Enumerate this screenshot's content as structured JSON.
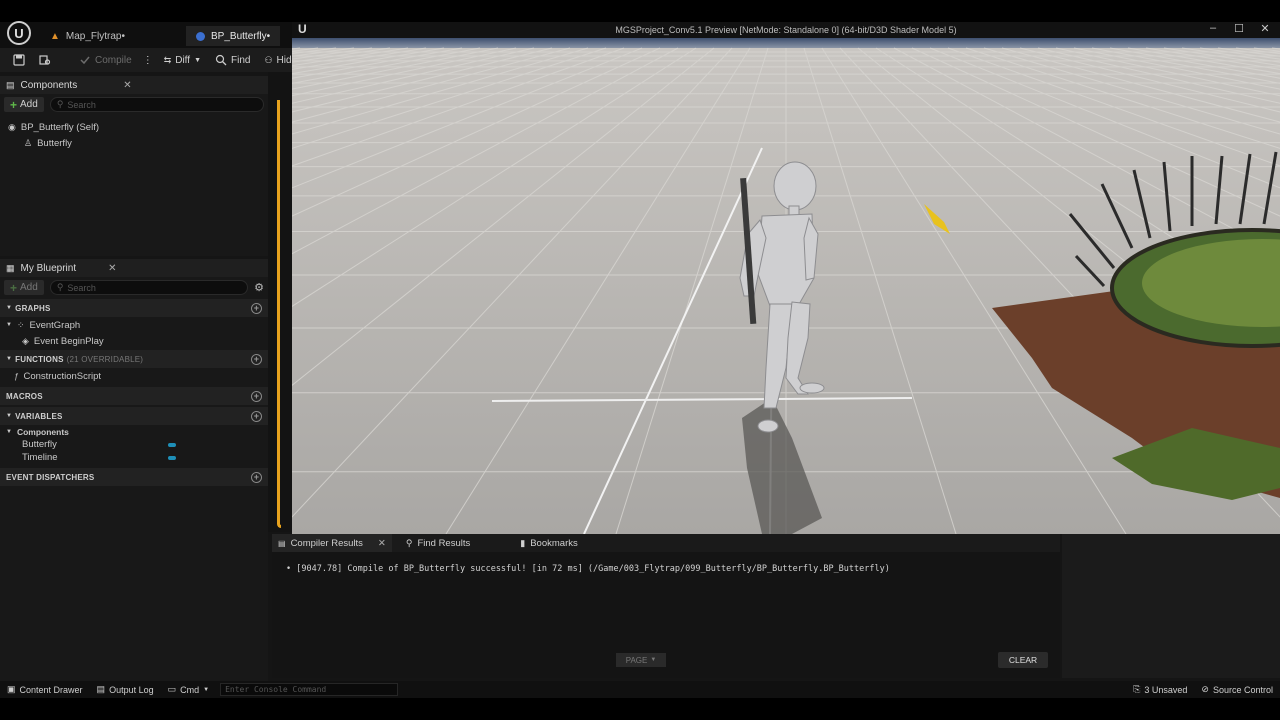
{
  "app": {
    "doc_tabs": [
      {
        "label": "Map_Flytrap•",
        "icon": "map-icon"
      },
      {
        "label": "BP_Butterfly•",
        "icon": "blueprint-icon"
      }
    ]
  },
  "toolbar": {
    "compile": "Compile",
    "diff": "Diff",
    "find": "Find",
    "hide": "Hide"
  },
  "components": {
    "tab": "Components",
    "add": "Add",
    "search_placeholder": "Search",
    "items": [
      {
        "label": "BP_Butterfly (Self)"
      },
      {
        "label": "Butterfly"
      }
    ]
  },
  "my_blueprint": {
    "tab": "My Blueprint",
    "add": "Add",
    "search_placeholder": "Search",
    "graphs_header": "GRAPHS",
    "event_graph": "EventGraph",
    "event_begin_play": "Event BeginPlay",
    "functions_header": "FUNCTIONS",
    "functions_sub": "(21 OVERRIDABLE)",
    "construction_script": "ConstructionScript",
    "macros_header": "MACROS",
    "variables_header": "VARIABLES",
    "components_category": "Components",
    "variables": [
      {
        "label": "Butterfly",
        "color": "#1e8fb8"
      },
      {
        "label": "Timeline",
        "color": "#1e8fb8"
      }
    ],
    "dispatchers_header": "EVENT DISPATCHERS"
  },
  "preview": {
    "title": "MGSProject_Conv5.1 Preview [NetMode: Standalone 0]  (64-bit/D3D Shader Model 5)",
    "ue_mark": "U",
    "minimize": "–",
    "maximize": "☐",
    "close": "✕"
  },
  "results": {
    "tabs": [
      {
        "label": "Compiler Results"
      },
      {
        "label": "Find Results"
      },
      {
        "label": "Bookmarks"
      }
    ],
    "log": "•  [9047.78] Compile of BP_Butterfly successful! [in 72 ms] (/Game/003_Flytrap/099_Butterfly/BP_Butterfly.BP_Butterfly)",
    "page": "PAGE",
    "clear": "CLEAR"
  },
  "statusbar": {
    "content_drawer": "Content Drawer",
    "output_log": "Output Log",
    "cmd": "Cmd",
    "console_placeholder": "Enter Console Command",
    "unsaved": "3 Unsaved",
    "source_control": "Source Control"
  },
  "colors": {
    "accent_orange": "#e8a31e",
    "variable_blue": "#1e8fb8",
    "add_green": "#5fb84a"
  }
}
